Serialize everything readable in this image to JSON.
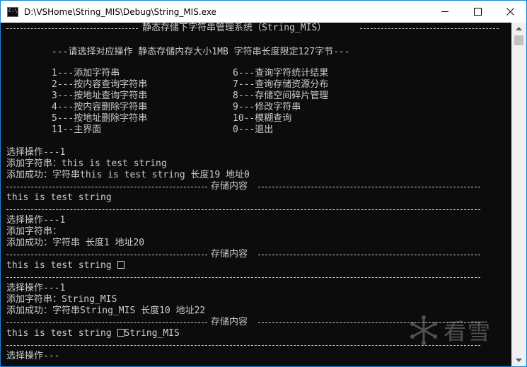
{
  "window": {
    "title": "D:\\VSHome\\String_MIS\\Debug\\String_MIS.exe",
    "icon_text": "C:\\",
    "controls": [
      "minimize-icon",
      "maximize-icon",
      "close-icon"
    ]
  },
  "console": {
    "header_title": "静态存储下字符串管理系统（String_MIS）",
    "subtitle": "---请选择对应操作 静态存储内存大小1MB 字符串长度限定127字节---",
    "menu_left": [
      "1---添加字符串",
      "2---按内容查询字符串",
      "3---按地址查询字符串",
      "4---按内容删除字符串",
      "5---按地址删除字符串",
      "11--主界面"
    ],
    "menu_right": [
      "6---查询字符统计结果",
      "7---查询存储资源分布",
      "8---存储空间碎片管理",
      "9---修改字符串",
      "10--模糊查询",
      "0---退出"
    ],
    "storage_label": "存储内容",
    "blocks": [
      {
        "select": "选择操作---1",
        "add_prompt": "添加字符串：this is test string",
        "result": "添加成功：字符串this is test string 长度19 地址0",
        "content": "this is test string",
        "content_suffix": ""
      },
      {
        "select": "选择操作---1",
        "add_prompt": "添加字符串：",
        "result": "添加成功：字符串 长度1 地址20",
        "content": "this is test string ",
        "content_suffix": ""
      },
      {
        "select": "选择操作---1",
        "add_prompt": "添加字符串：String_MIS",
        "result": "添加成功：字符串String_MIS 长度10 地址22",
        "content": "this is test string ",
        "content_suffix": "String_MIS"
      }
    ],
    "final_prompt": "选择操作---"
  },
  "scrollbar": {
    "up_icon": "triangle-up-icon",
    "down_icon": "triangle-down-icon"
  },
  "watermark": {
    "text": "看雪",
    "icon": "snowflake-icon"
  },
  "colors": {
    "console_bg": "#0c0c0c",
    "console_fg": "#cccccc",
    "titlebar_bg": "#ffffff",
    "window_border": "#1883d7"
  }
}
